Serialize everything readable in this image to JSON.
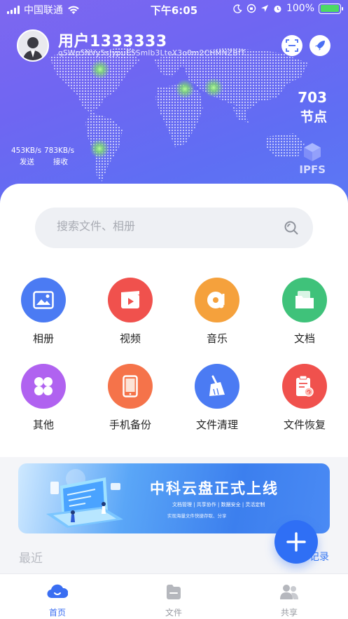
{
  "status_bar": {
    "carrier": "中国联通",
    "time": "下午6:05",
    "battery": "100%"
  },
  "user": {
    "name": "用户1333333",
    "hash": "qSWp5NVy5sJypuESSmlb3LteX3o0m2CHMNZBfT..."
  },
  "nodes": {
    "count": "703",
    "label": "节点"
  },
  "speeds": {
    "upload": "453KB/s",
    "upload_label": "发送",
    "download": "783KB/s",
    "download_label": "接收"
  },
  "ipfs_label": "IPFS",
  "search": {
    "placeholder": "搜索文件、相册"
  },
  "categories": [
    {
      "label": "相册",
      "icon": "photo-icon",
      "color": "#4b7bf3"
    },
    {
      "label": "视频",
      "icon": "video-icon",
      "color": "#f0514d"
    },
    {
      "label": "音乐",
      "icon": "music-icon",
      "color": "#f5a13c"
    },
    {
      "label": "文档",
      "icon": "document-icon",
      "color": "#3fc27a"
    },
    {
      "label": "其他",
      "icon": "other-icon",
      "color": "#b062f0"
    },
    {
      "label": "手机备份",
      "icon": "phone-backup-icon",
      "color": "#f5734a"
    },
    {
      "label": "文件清理",
      "icon": "broom-icon",
      "color": "#4b7bf3"
    },
    {
      "label": "文件恢复",
      "icon": "file-recover-icon",
      "color": "#f0514d"
    }
  ],
  "banner": {
    "title": "中科云盘正式上线",
    "subtitle": "文档管理 | 共享协作 | 数据安全 | 灵活定制",
    "caption": "实现海量文件快捷存取、分享"
  },
  "recent": {
    "label": "最近",
    "records_link": "记录"
  },
  "tabs": [
    {
      "label": "首页",
      "icon": "home-cloud-icon",
      "active": true
    },
    {
      "label": "文件",
      "icon": "file-icon",
      "active": false
    },
    {
      "label": "共享",
      "icon": "share-users-icon",
      "active": false
    }
  ]
}
